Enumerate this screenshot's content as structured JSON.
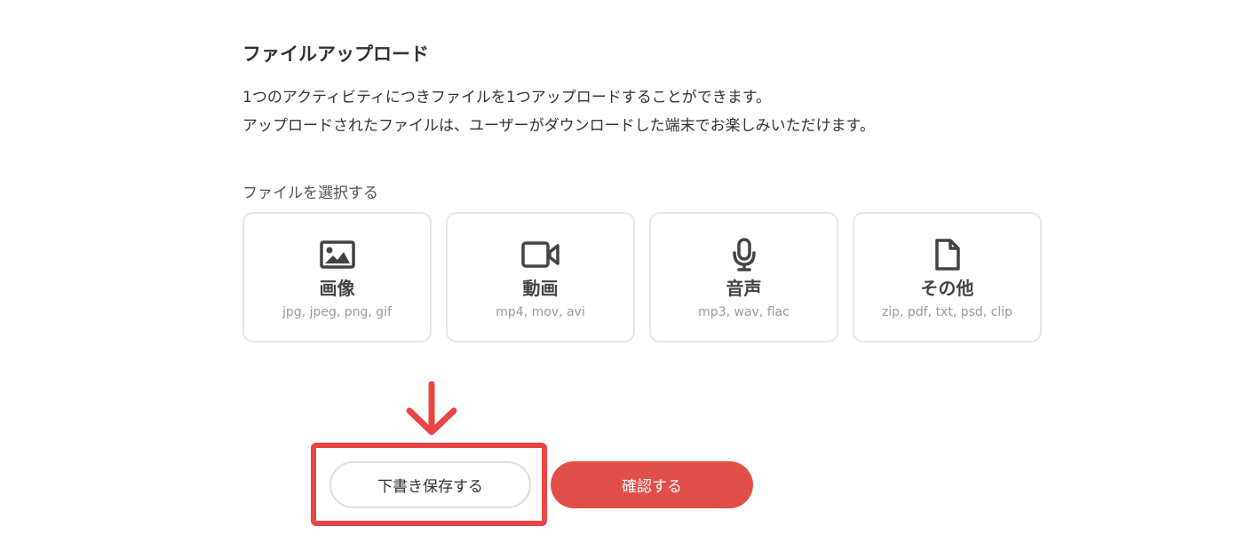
{
  "upload_section": {
    "title": "ファイルアップロード",
    "description_line1": "1つのアクティビティにつきファイルを1つアップロードすることができます。",
    "description_line2": "アップロードされたファイルは、ユーザーがダウンロードした端末でお楽しみいただけます。",
    "select_label": "ファイルを選択する"
  },
  "file_types": [
    {
      "label": "画像",
      "formats": "jpg, jpeg, png, gif",
      "icon": "image-icon"
    },
    {
      "label": "動画",
      "formats": "mp4, mov, avi",
      "icon": "video-icon"
    },
    {
      "label": "音声",
      "formats": "mp3, wav, flac",
      "icon": "microphone-icon"
    },
    {
      "label": "その他",
      "formats": "zip, pdf, txt, psd, clip",
      "icon": "file-icon"
    }
  ],
  "actions": {
    "save_draft_label": "下書き保存する",
    "confirm_label": "確認する"
  },
  "colors": {
    "accent": "#e05048",
    "highlight": "#e94545",
    "icon": "#444444",
    "border": "#e6e6e6"
  }
}
